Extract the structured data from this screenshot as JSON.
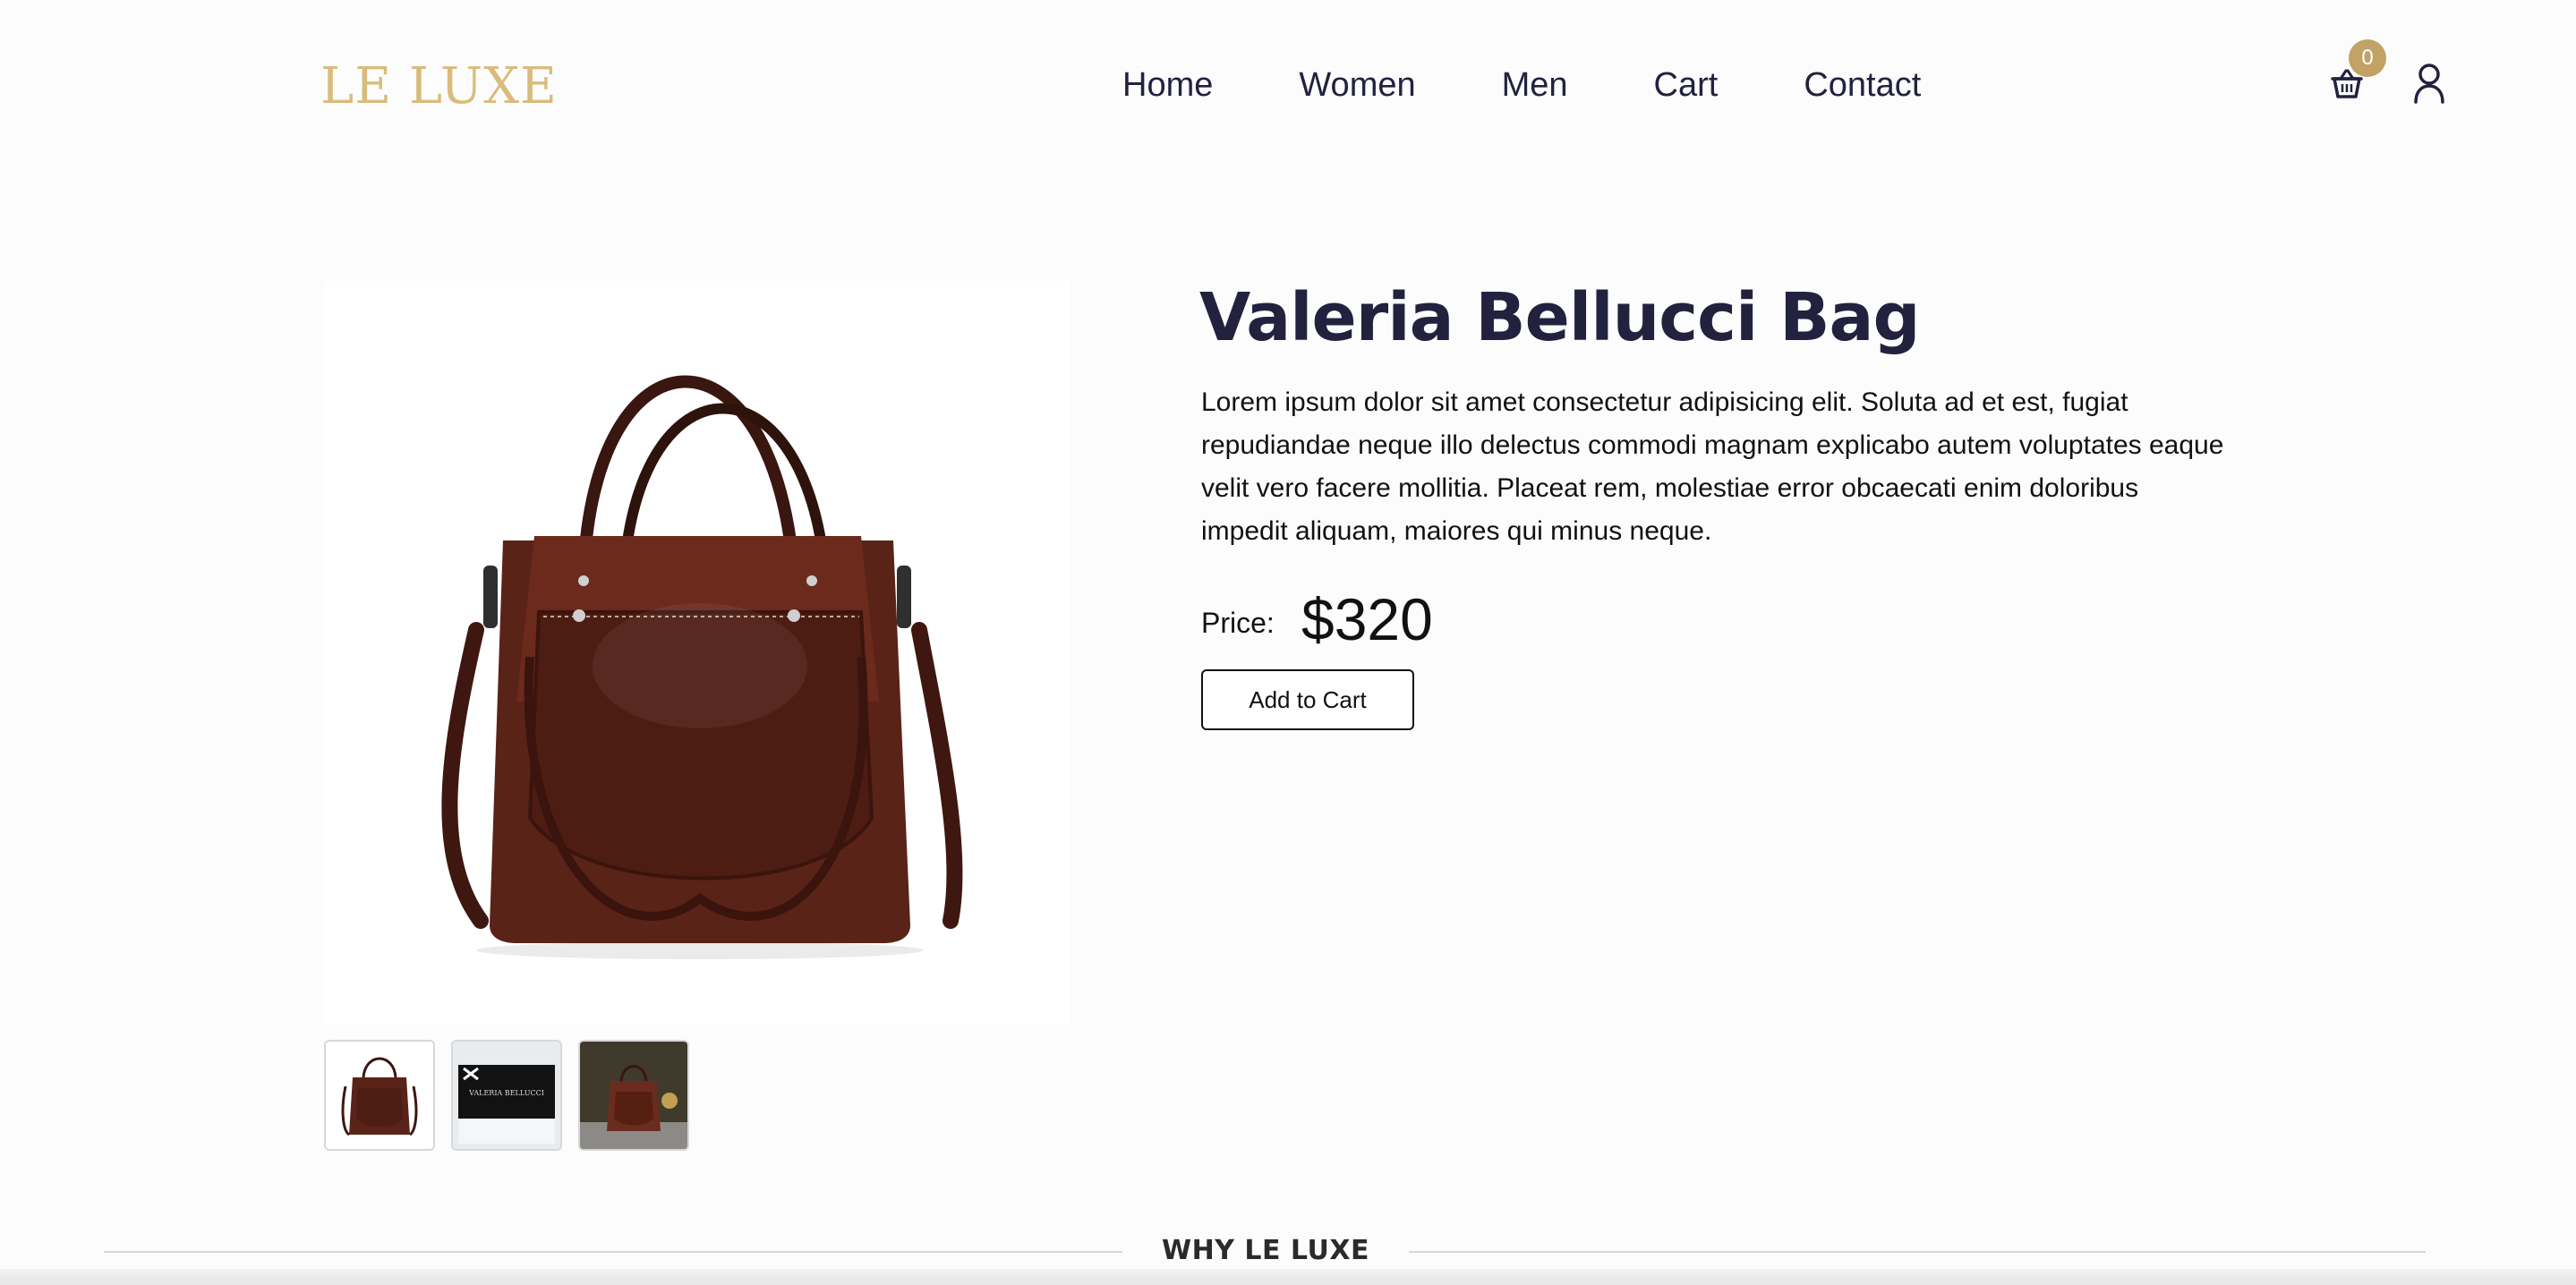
{
  "header": {
    "logo": "LE LUXE",
    "nav": [
      "Home",
      "Women",
      "Men",
      "Cart",
      "Contact"
    ],
    "cart_count": "0",
    "icons": {
      "cart": "basket-icon",
      "account": "user-icon"
    }
  },
  "product": {
    "title": "Valeria Bellucci Bag",
    "description": "Lorem ipsum dolor sit amet consectetur adipisicing elit. Soluta ad et est, fugiat repudiandae neque illo delectus commodi magnam explicabo autem voluptates eaque velit vero facere mollitia. Placeat rem, molestiae error obcaecati enim doloribus impedit aliquam, maiores qui minus neque.",
    "price_label": "Price:",
    "price": "$320",
    "add_to_cart": "Add to Cart",
    "thumbnails": [
      "bag-front",
      "bag-box",
      "bag-lifestyle"
    ]
  },
  "section": {
    "label": "WHY LE LUXE"
  },
  "colors": {
    "accent_gold": "#c2a265",
    "logo_gold": "#d9bc7c",
    "navy": "#22223f",
    "bag_brown": "#5a2318"
  }
}
